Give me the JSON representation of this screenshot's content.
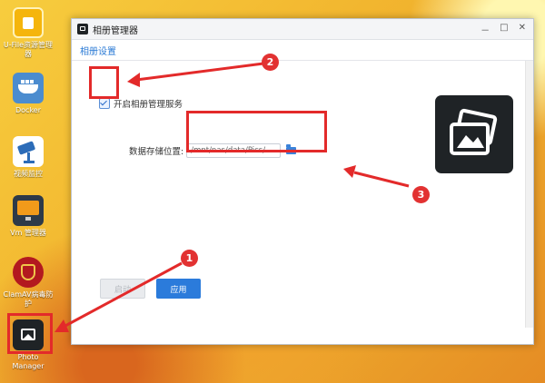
{
  "desktop": {
    "icons": [
      {
        "label": "U-File资源管理器",
        "icon": "ufile-icon"
      },
      {
        "label": "Docker",
        "icon": "docker-icon"
      },
      {
        "label": "视频监控",
        "icon": "camera-icon"
      },
      {
        "label": "Vm 管理器",
        "icon": "vm-icon"
      },
      {
        "label": "ClamAV病毒防护",
        "icon": "shield-icon"
      },
      {
        "label": "Photo Manager",
        "icon": "photo-icon"
      }
    ]
  },
  "window": {
    "title": "相册管理器",
    "controls": [
      "－",
      "□",
      "✕"
    ],
    "tab": "相册设置"
  },
  "settings": {
    "enable_label": "开启相册管理服务",
    "enabled": true,
    "path_label": "数据存储位置:",
    "path_value": "/mnt/nas/data/Pics/"
  },
  "buttons": {
    "start": "启动",
    "apply": "应用"
  },
  "annotations": {
    "badges": [
      "1",
      "2",
      "3"
    ],
    "color": "#e32a2a"
  }
}
